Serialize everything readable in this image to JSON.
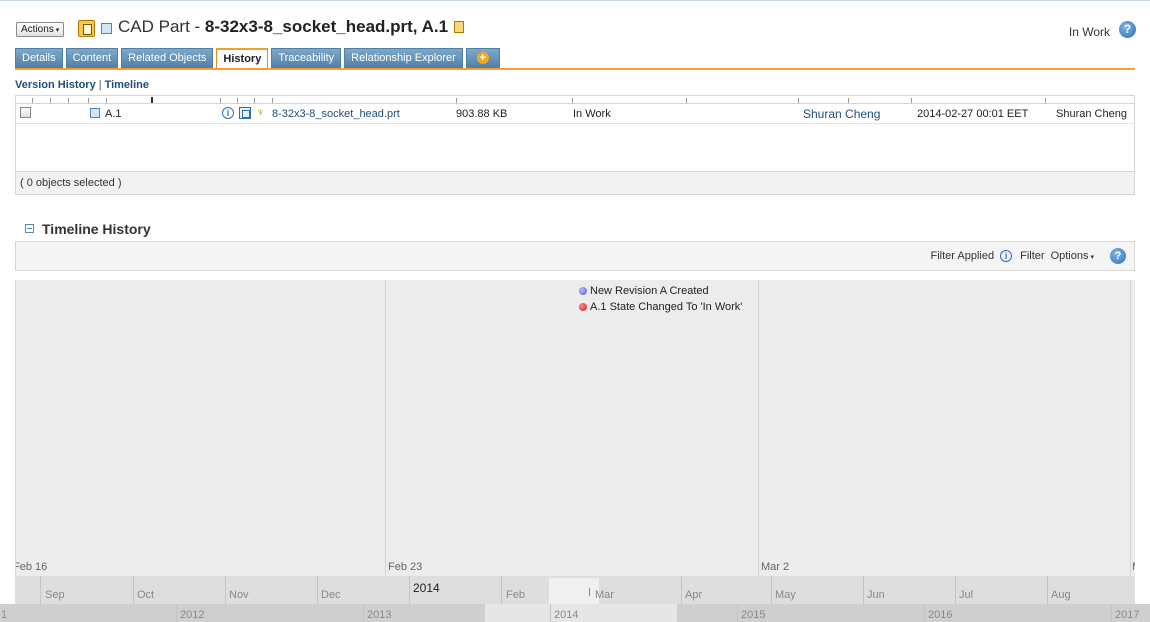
{
  "header": {
    "actions_label": "Actions",
    "object_type": "CAD Part - ",
    "object_name": "8-32x3-8_socket_head.prt, A.1",
    "status": "In Work"
  },
  "tabs": [
    {
      "label": "Details",
      "active": false
    },
    {
      "label": "Content",
      "active": false
    },
    {
      "label": "Related Objects",
      "active": false
    },
    {
      "label": "History",
      "active": true
    },
    {
      "label": "Traceability",
      "active": false
    },
    {
      "label": "Relationship Explorer",
      "active": false
    }
  ],
  "subnav": {
    "version_history": "Version History",
    "timeline": "Timeline"
  },
  "table": {
    "rows": [
      {
        "version": "A.1",
        "name": "8-32x3-8_socket_head.prt",
        "size": "903.88 KB",
        "state": "In Work",
        "modified_by": "Shuran Cheng",
        "date": "2014-02-27 00:01 EET",
        "created_by": "Shuran Cheng"
      }
    ],
    "footer": "( 0 objects selected )"
  },
  "timeline": {
    "title": "Timeline History",
    "filter_applied": "Filter Applied",
    "filter": "Filter",
    "options": "Options",
    "events": [
      {
        "label": "New Revision A Created",
        "color": "#5b5bd6"
      },
      {
        "label": "A.1 State Changed To 'In Work'",
        "color": "#d91a1a"
      }
    ],
    "days": [
      "Feb 16",
      "Feb 23",
      "Mar 2",
      "Ma"
    ],
    "months": [
      "Sep",
      "Oct",
      "Nov",
      "Dec",
      "2014",
      "Feb",
      "Mar",
      "Apr",
      "May",
      "Jun",
      "Jul",
      "Aug"
    ],
    "years": [
      "1",
      "2012",
      "2013",
      "2014",
      "2015",
      "2016",
      "2017"
    ]
  },
  "colors": {
    "tab_blue": "#4f7fa5",
    "tab_active_accent": "#f0a030",
    "link": "#1f4e79"
  }
}
